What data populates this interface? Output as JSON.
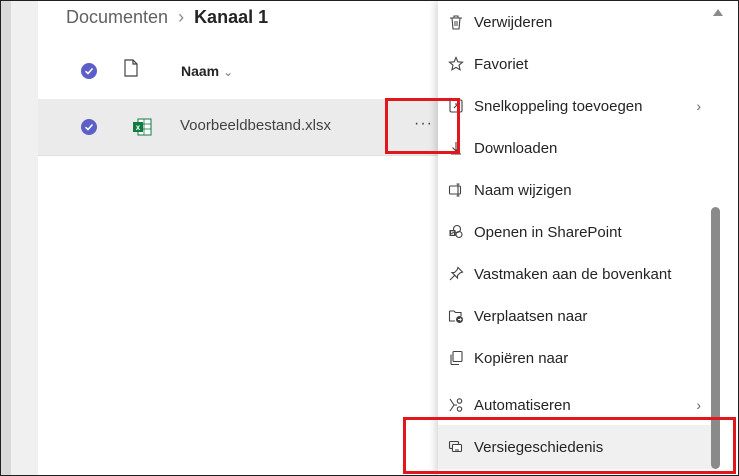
{
  "breadcrumb": {
    "root": "Documenten",
    "separator": "›",
    "current": "Kanaal 1"
  },
  "list": {
    "header": {
      "name_label": "Naam",
      "sort_icon": "chevron-down-icon"
    },
    "rows": [
      {
        "name": "Voorbeeldbestand.xlsx",
        "type_icon": "excel-file-icon",
        "more_label": "···"
      }
    ]
  },
  "context_menu": {
    "items": [
      {
        "label": "Verwijderen",
        "icon": "trash-icon"
      },
      {
        "label": "Favoriet",
        "icon": "star-icon"
      },
      {
        "label": "Snelkoppeling toevoegen",
        "icon": "shortcut-icon",
        "submenu": "›"
      },
      {
        "label": "Downloaden",
        "icon": "download-icon"
      },
      {
        "label": "Naam wijzigen",
        "icon": "rename-icon"
      },
      {
        "label": "Openen in SharePoint",
        "icon": "sharepoint-icon"
      },
      {
        "label": "Vastmaken aan de bovenkant",
        "icon": "pin-icon"
      },
      {
        "label": "Verplaatsen naar",
        "icon": "move-folder-icon"
      },
      {
        "label": "Kopiëren naar",
        "icon": "copy-icon"
      },
      {
        "label": "Automatiseren",
        "icon": "automate-icon",
        "submenu": "›"
      },
      {
        "label": "Versiegeschiedenis",
        "icon": "version-history-icon"
      }
    ]
  },
  "colors": {
    "accent": "#5b5fc7",
    "highlight_box": "#e2161d",
    "excel_green": "#107c41"
  }
}
